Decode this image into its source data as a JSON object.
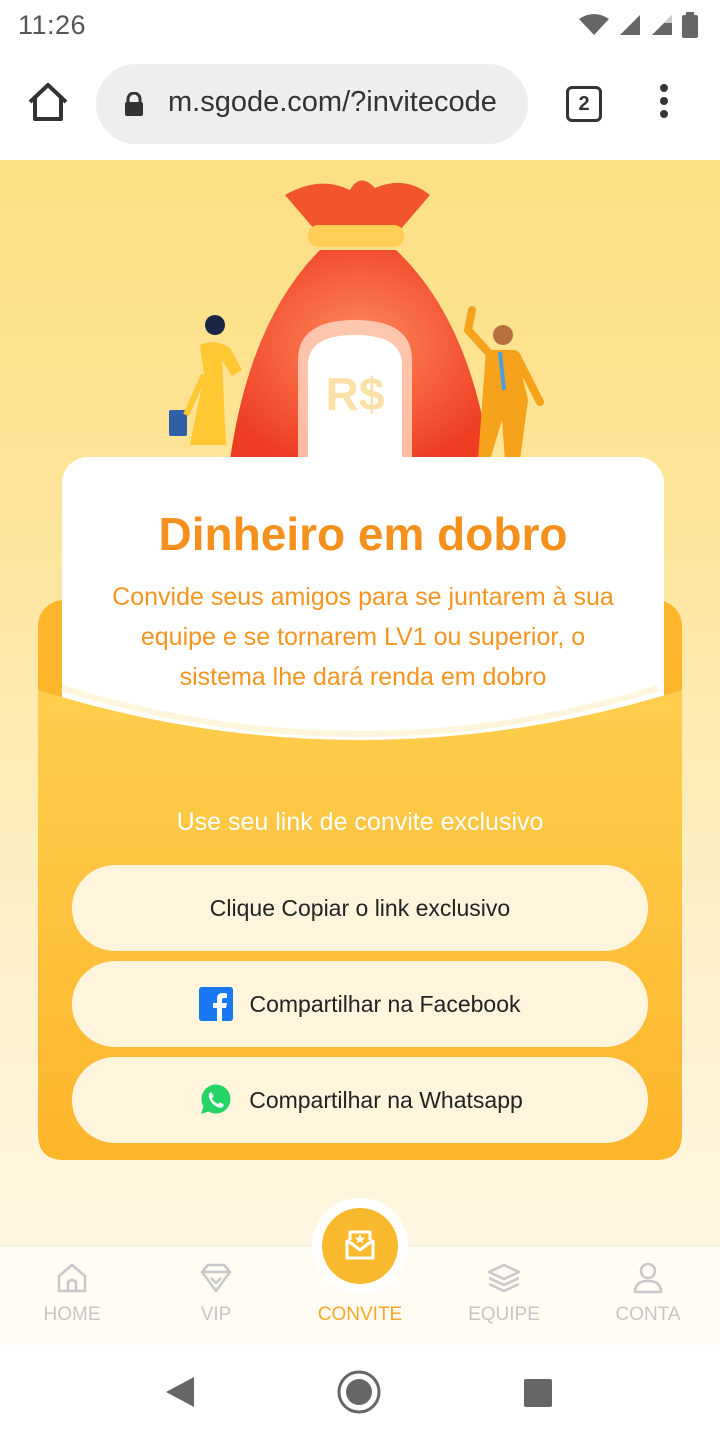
{
  "status_bar": {
    "time": "11:26"
  },
  "browser": {
    "url": "m.sgode.com/?invitecode",
    "tab_count": "2"
  },
  "card": {
    "title": "Dinheiro em dobro",
    "description": "Convide seus amigos para se juntarem à sua equipe e se tornarem LV1 ou superior, o sistema lhe dará renda em dobro"
  },
  "hero": {
    "currency": "R$"
  },
  "invite": {
    "heading": "Use seu link de convite exclusivo",
    "copy_label": "Clique Copiar o link exclusivo",
    "facebook_label": "Compartilhar na Facebook",
    "whatsapp_label": "Compartilhar na Whatsapp"
  },
  "nav": {
    "items": [
      {
        "label": "HOME",
        "icon": "home-icon"
      },
      {
        "label": "VIP",
        "icon": "diamond-icon"
      },
      {
        "label": "CONVITE",
        "icon": "invite-icon",
        "active": true
      },
      {
        "label": "EQUIPE",
        "icon": "layers-icon"
      },
      {
        "label": "CONTA",
        "icon": "user-icon"
      }
    ]
  },
  "colors": {
    "accent": "#f5901d",
    "nav_active": "#f9a825",
    "envelope": "#fdb52b"
  }
}
